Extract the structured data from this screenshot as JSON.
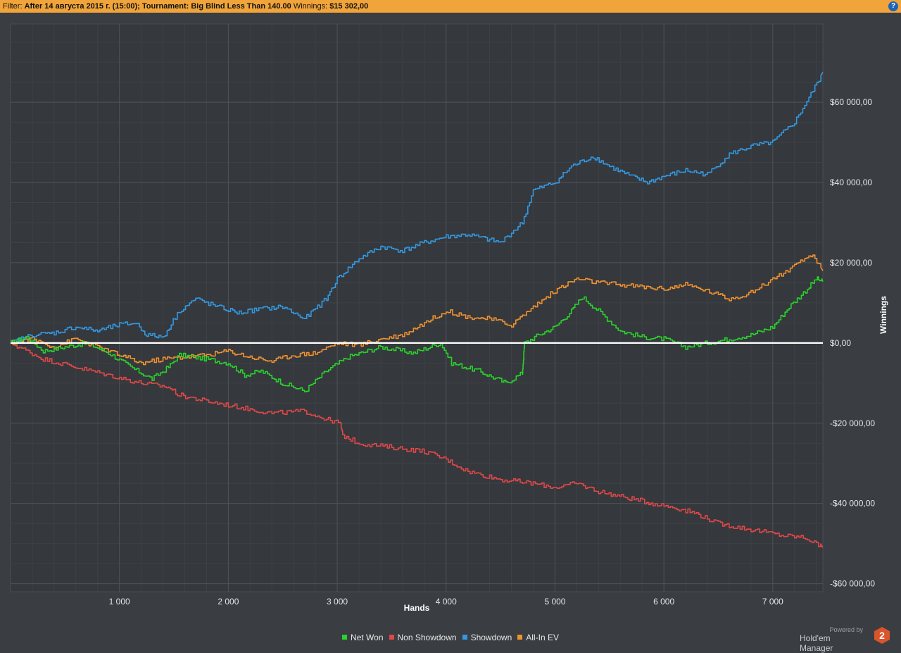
{
  "filter": {
    "prefix": "Filter:",
    "text": "After 14 августа 2015 г. (15:00); Tournament: Big Blind Less Than 140.00",
    "winnings_label": "Winnings:",
    "winnings_value": "$15 302,00"
  },
  "help_icon": "?",
  "branding": {
    "powered_by": "Powered by",
    "name": "Hold'em Manager",
    "logo_text": "2"
  },
  "chart_data": {
    "type": "line",
    "xlabel": "Hands",
    "ylabel": "Winnings",
    "xlim": [
      0,
      7460
    ],
    "ylim": [
      -62000,
      79500
    ],
    "x_ticks": [
      1000,
      2000,
      3000,
      4000,
      5000,
      6000,
      7000
    ],
    "x_tick_labels": [
      "1 000",
      "2 000",
      "3 000",
      "4 000",
      "5 000",
      "6 000",
      "7 000"
    ],
    "y_ticks": [
      60000,
      40000,
      20000,
      0,
      -20000,
      -40000,
      -60000
    ],
    "y_tick_labels": [
      "$60 000,00",
      "$40 000,00",
      "$20 000,00",
      "$0,00",
      "-$20 000,00",
      "-$40 000,00",
      "-$60 000,00"
    ],
    "grid": true,
    "legend_position": "bottom",
    "series": [
      {
        "name": "Net Won",
        "color": "#29d32b",
        "points": [
          [
            0,
            0
          ],
          [
            150,
            1500
          ],
          [
            300,
            -2000
          ],
          [
            500,
            -1000
          ],
          [
            700,
            0
          ],
          [
            900,
            -2500
          ],
          [
            1100,
            -6000
          ],
          [
            1300,
            -9000
          ],
          [
            1450,
            -6000
          ],
          [
            1550,
            -3000
          ],
          [
            1800,
            -4000
          ],
          [
            2000,
            -5000
          ],
          [
            2150,
            -8000
          ],
          [
            2300,
            -7000
          ],
          [
            2500,
            -10000
          ],
          [
            2700,
            -12000
          ],
          [
            2900,
            -7000
          ],
          [
            3100,
            -3500
          ],
          [
            3400,
            -1000
          ],
          [
            3700,
            -2500
          ],
          [
            3950,
            0
          ],
          [
            4050,
            -5000
          ],
          [
            4300,
            -7000
          ],
          [
            4550,
            -10000
          ],
          [
            4700,
            -7500
          ],
          [
            4720,
            0
          ],
          [
            4850,
            2000
          ],
          [
            5000,
            4000
          ],
          [
            5150,
            8000
          ],
          [
            5250,
            11500
          ],
          [
            5400,
            8000
          ],
          [
            5600,
            3000
          ],
          [
            5800,
            1500
          ],
          [
            6000,
            1000
          ],
          [
            6200,
            -1000
          ],
          [
            6400,
            0
          ],
          [
            6600,
            1000
          ],
          [
            6800,
            2000
          ],
          [
            7000,
            4000
          ],
          [
            7150,
            9000
          ],
          [
            7300,
            13000
          ],
          [
            7400,
            16000
          ],
          [
            7460,
            15300
          ]
        ]
      },
      {
        "name": "Non Showdown",
        "color": "#e04848",
        "points": [
          [
            0,
            0
          ],
          [
            300,
            -4000
          ],
          [
            600,
            -6000
          ],
          [
            900,
            -8000
          ],
          [
            1200,
            -10000
          ],
          [
            1450,
            -11000
          ],
          [
            1550,
            -13000
          ],
          [
            1800,
            -14500
          ],
          [
            2100,
            -16000
          ],
          [
            2400,
            -17500
          ],
          [
            2700,
            -17000
          ],
          [
            2900,
            -19000
          ],
          [
            3030,
            -20000
          ],
          [
            3050,
            -23000
          ],
          [
            3200,
            -25000
          ],
          [
            3500,
            -26000
          ],
          [
            3800,
            -27000
          ],
          [
            4000,
            -29000
          ],
          [
            4200,
            -32000
          ],
          [
            4500,
            -34000
          ],
          [
            4800,
            -35000
          ],
          [
            5000,
            -36000
          ],
          [
            5200,
            -35000
          ],
          [
            5400,
            -37000
          ],
          [
            5650,
            -38500
          ],
          [
            5900,
            -40000
          ],
          [
            6100,
            -41000
          ],
          [
            6300,
            -42500
          ],
          [
            6500,
            -45000
          ],
          [
            6700,
            -46000
          ],
          [
            6900,
            -47000
          ],
          [
            7100,
            -48000
          ],
          [
            7300,
            -48500
          ],
          [
            7460,
            -51000
          ]
        ]
      },
      {
        "name": "Showdown",
        "color": "#3399e0",
        "points": [
          [
            0,
            0
          ],
          [
            200,
            2000
          ],
          [
            400,
            2500
          ],
          [
            600,
            4000
          ],
          [
            800,
            3000
          ],
          [
            1000,
            4500
          ],
          [
            1150,
            5000
          ],
          [
            1250,
            2000
          ],
          [
            1400,
            1500
          ],
          [
            1550,
            8000
          ],
          [
            1700,
            11000
          ],
          [
            1900,
            9000
          ],
          [
            2100,
            7500
          ],
          [
            2300,
            8500
          ],
          [
            2500,
            9000
          ],
          [
            2700,
            6000
          ],
          [
            2900,
            11000
          ],
          [
            3000,
            16000
          ],
          [
            3200,
            21000
          ],
          [
            3400,
            24000
          ],
          [
            3600,
            23000
          ],
          [
            3800,
            25000
          ],
          [
            4000,
            26500
          ],
          [
            4200,
            27000
          ],
          [
            4500,
            25000
          ],
          [
            4700,
            30000
          ],
          [
            4800,
            38000
          ],
          [
            5000,
            40000
          ],
          [
            5150,
            44000
          ],
          [
            5350,
            46500
          ],
          [
            5500,
            44000
          ],
          [
            5700,
            41500
          ],
          [
            5850,
            40000
          ],
          [
            6000,
            41500
          ],
          [
            6200,
            43000
          ],
          [
            6400,
            42000
          ],
          [
            6600,
            47000
          ],
          [
            6800,
            49000
          ],
          [
            7000,
            50000
          ],
          [
            7200,
            55000
          ],
          [
            7350,
            62000
          ],
          [
            7460,
            67500
          ]
        ]
      },
      {
        "name": "All-In EV",
        "color": "#f0922f",
        "points": [
          [
            0,
            0
          ],
          [
            200,
            1000
          ],
          [
            400,
            -1000
          ],
          [
            600,
            1000
          ],
          [
            800,
            -1000
          ],
          [
            1000,
            -3000
          ],
          [
            1200,
            -5000
          ],
          [
            1400,
            -4000
          ],
          [
            1600,
            -3500
          ],
          [
            1800,
            -3000
          ],
          [
            2000,
            -2000
          ],
          [
            2200,
            -3500
          ],
          [
            2400,
            -4500
          ],
          [
            2600,
            -3000
          ],
          [
            2800,
            -2500
          ],
          [
            3000,
            0
          ],
          [
            3200,
            -500
          ],
          [
            3400,
            1000
          ],
          [
            3600,
            2000
          ],
          [
            3800,
            5000
          ],
          [
            4000,
            8000
          ],
          [
            4200,
            6500
          ],
          [
            4400,
            6000
          ],
          [
            4600,
            4500
          ],
          [
            4800,
            9000
          ],
          [
            5000,
            13000
          ],
          [
            5200,
            16000
          ],
          [
            5400,
            15000
          ],
          [
            5600,
            14500
          ],
          [
            5800,
            14000
          ],
          [
            6000,
            13500
          ],
          [
            6200,
            14500
          ],
          [
            6400,
            13000
          ],
          [
            6600,
            11000
          ],
          [
            6800,
            12500
          ],
          [
            7000,
            16000
          ],
          [
            7200,
            19000
          ],
          [
            7350,
            22000
          ],
          [
            7460,
            18000
          ]
        ]
      }
    ]
  }
}
